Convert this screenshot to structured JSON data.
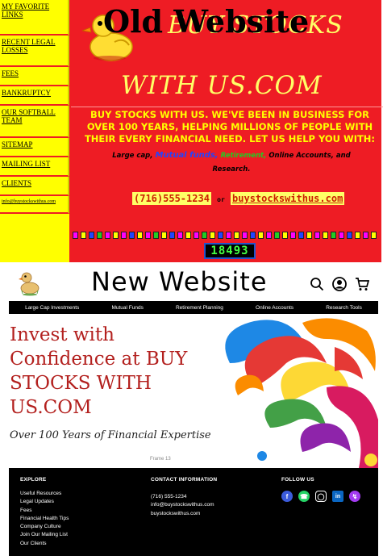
{
  "old_site": {
    "title": "Old Website",
    "brand_line1": "BUY STOCKS",
    "brand_line2": "WITH US.COM",
    "sidebar_links": [
      "MY FAVORITE LINKS",
      "RECENT LEGAL LOSSES",
      "FEES",
      "BANKRUPTCY",
      "OUR SOFTBALL TEAM",
      "SITEMAP",
      "MAILING LIST",
      "CLIENTS",
      "info@buystockswithus.com"
    ],
    "pitch": "BUY STOCKS WITH US. WE'VE BEEN IN BUSINESS FOR\nOVER 100 YEARS, HELPING MILLIONS OF PEOPLE WITH\nTHEIR EVERY FINANCIAL NEED. LET US HELP YOU WITH:",
    "products": {
      "p1": "Large cap,",
      "p2": "Mutual funds,",
      "p3": "Retirement,",
      "p4": "Online Accounts, and",
      "p5": "Research."
    },
    "phone": "(716)555-1234",
    "or": "or",
    "url": "buystockswithus.com",
    "counter": "18493",
    "dot_colors": [
      "#ff00ff",
      "#ffff00",
      "#2244ff",
      "#22cc22",
      "#ff00ff",
      "#ffff00",
      "#ff00ff",
      "#2244ff",
      "#ffff00",
      "#ff00ff",
      "#22cc22",
      "#ffff00",
      "#2244ff",
      "#ff00ff",
      "#ffff00",
      "#ff00ff",
      "#22cc22",
      "#ffff00",
      "#2244ff",
      "#ff00ff",
      "#ffff00",
      "#ff00ff",
      "#2244ff",
      "#ffff00",
      "#ff00ff",
      "#22cc22",
      "#ffff00",
      "#ff00ff",
      "#2244ff",
      "#ffff00",
      "#ff00ff",
      "#ffff00",
      "#22cc22",
      "#ff00ff",
      "#2244ff",
      "#ffff00",
      "#ff00ff",
      "#ffff00"
    ]
  },
  "new_site": {
    "title": "New Website",
    "header_icons": [
      "search-icon",
      "account-icon",
      "cart-icon"
    ],
    "nav": [
      "Large Cap Investments",
      "Mutual Funds",
      "Retirement Planning",
      "Online Accounts",
      "Research Tools"
    ],
    "hero": {
      "heading": "Invest with Confidence at BUY STOCKS WITH US.COM",
      "subheading": "Over 100 Years of Financial Expertise",
      "frame_label": "Frame 13"
    },
    "footer": {
      "explore_title": "EXPLORE",
      "explore_links": [
        "Useful Resources",
        "Legal Updates",
        "Fees",
        "Financial Health Tips",
        "Company Culture",
        "Join Our Mailing List",
        "Our Clients"
      ],
      "contact_title": "CONTACT INFORMATION",
      "contact_lines": [
        "(716) 555-1234",
        "info@buystockswithus.com",
        "buystockswithus.com"
      ],
      "follow_title": "FOLLOW US",
      "social": [
        {
          "icon": "facebook-icon",
          "color": "#3b5bdb"
        },
        {
          "icon": "whatsapp-icon",
          "color": "#25d366"
        },
        {
          "icon": "instagram-icon",
          "color": "#000000"
        },
        {
          "icon": "linkedin-icon",
          "color": "#0a66c2"
        },
        {
          "icon": "messenger-icon",
          "color": "#a33bf2"
        }
      ]
    }
  }
}
